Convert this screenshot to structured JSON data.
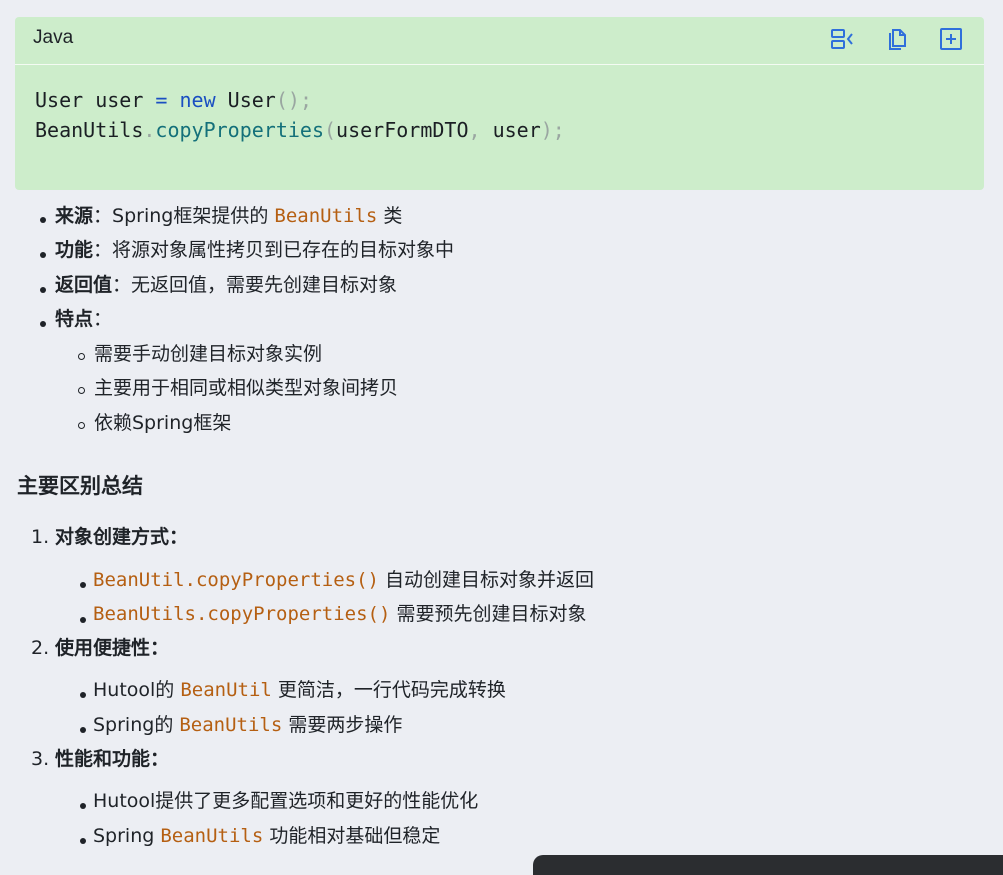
{
  "code_block": {
    "language": "Java",
    "toolbar": {
      "wrap_icon": "wrap-lines-icon",
      "copy_icon": "copy-icon",
      "insert_icon": "insert-icon"
    },
    "lines": [
      {
        "t1": "User user ",
        "op": "=",
        "kw": " new",
        "t2": " User",
        "p": "();"
      },
      {
        "t1": "BeanUtils",
        "dot": ".",
        "fn": "copyProperties",
        "p1": "(",
        "a1": "userFormDTO",
        "comma": ",",
        "a2": " user",
        "p2": ");"
      }
    ]
  },
  "spring_section": {
    "items": [
      {
        "label": "来源",
        "sep": "：",
        "pre": "Spring框架提供的 ",
        "code": "BeanUtils",
        "post": " 类"
      },
      {
        "label": "功能",
        "sep": "：",
        "text": "将源对象属性拷贝到已存在的目标对象中"
      },
      {
        "label": "返回值",
        "sep": "：",
        "text": "无返回值，需要先创建目标对象"
      },
      {
        "label": "特点",
        "sep": "："
      }
    ],
    "features": [
      "需要手动创建目标对象实例",
      "主要用于相同或相似类型对象间拷贝",
      "依赖Spring框架"
    ]
  },
  "summary": {
    "heading": "主要区别总结",
    "points": [
      {
        "num": "1.",
        "title": "对象创建方式：",
        "subs": [
          {
            "code": "BeanUtil.copyProperties()",
            "post": " 自动创建目标对象并返回"
          },
          {
            "code": "BeanUtils.copyProperties()",
            "post": " 需要预先创建目标对象"
          }
        ]
      },
      {
        "num": "2.",
        "title": "使用便捷性：",
        "subs": [
          {
            "pre": "Hutool的 ",
            "code": "BeanUtil",
            "post": " 更简洁，一行代码完成转换"
          },
          {
            "pre": "Spring的 ",
            "code": "BeanUtils",
            "post": " 需要两步操作"
          }
        ]
      },
      {
        "num": "3.",
        "title": "性能和功能：",
        "subs": [
          {
            "pre": "Hutool提供了更多配置选项和更好的性能优化"
          },
          {
            "pre": "Spring ",
            "code": "BeanUtils",
            "post": " 功能相对基础但稳定"
          }
        ]
      }
    ]
  }
}
